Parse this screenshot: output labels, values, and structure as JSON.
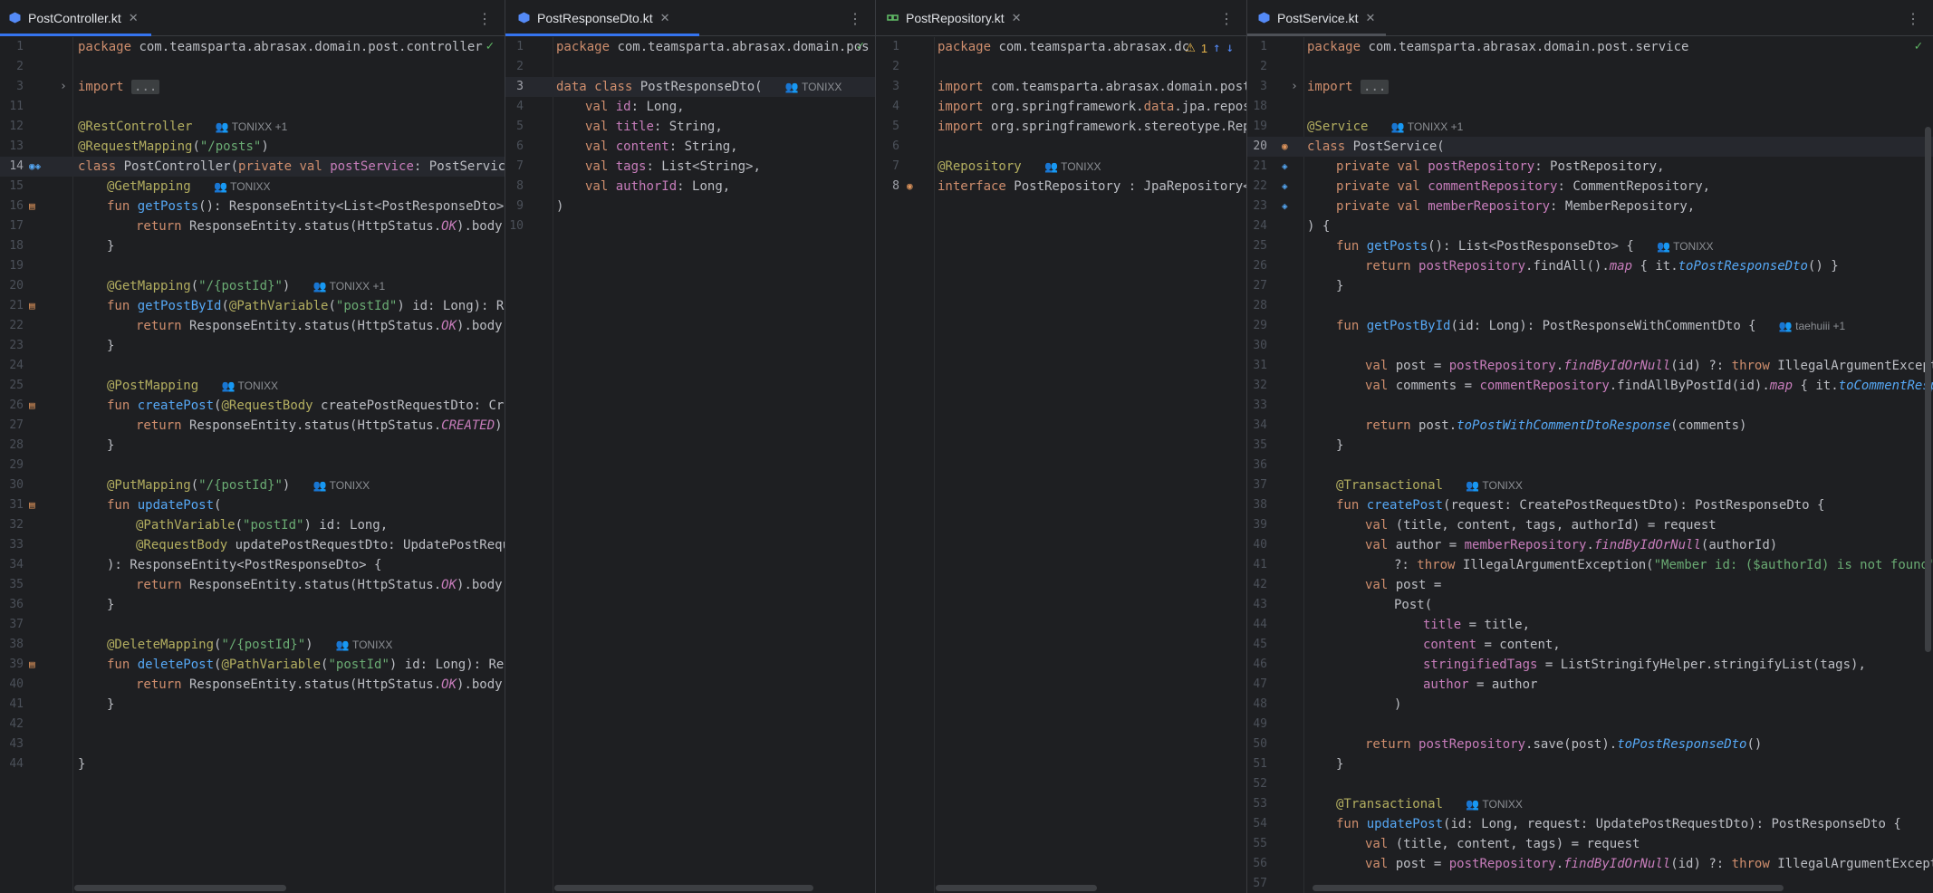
{
  "pane1": {
    "tab": "PostController.kt",
    "lines": [
      {
        "n": "1",
        "code": "package com.teamsparta.abrasax.domain.post.controller"
      },
      {
        "n": "2",
        "code": ""
      },
      {
        "n": "3",
        "code": "import ..."
      },
      {
        "n": "11",
        "code": ""
      },
      {
        "n": "12",
        "code": "@RestController  TONIXX +1"
      },
      {
        "n": "13",
        "code": "@RequestMapping(\"/posts\")"
      },
      {
        "n": "14",
        "code": "class PostController(private val postService: PostService)"
      },
      {
        "n": "15",
        "code": "@GetMapping  TONIXX"
      },
      {
        "n": "16",
        "code": "fun getPosts(): ResponseEntity<List<PostResponseDto>> {"
      },
      {
        "n": "17",
        "code": "return ResponseEntity.status(HttpStatus.OK).body(pos"
      },
      {
        "n": "18",
        "code": "}"
      },
      {
        "n": "19",
        "code": ""
      },
      {
        "n": "20",
        "code": "@GetMapping(\"/{postId}\")  TONIXX +1"
      },
      {
        "n": "21",
        "code": "fun getPostById(@PathVariable(\"postId\") id: Long): Respo"
      },
      {
        "n": "22",
        "code": "return ResponseEntity.status(HttpStatus.OK).body(pos"
      },
      {
        "n": "23",
        "code": "}"
      },
      {
        "n": "24",
        "code": ""
      },
      {
        "n": "25",
        "code": "@PostMapping  TONIXX"
      },
      {
        "n": "26",
        "code": "fun createPost(@RequestBody createPostRequestDto: Create"
      },
      {
        "n": "27",
        "code": "return ResponseEntity.status(HttpStatus.CREATED).boc"
      },
      {
        "n": "28",
        "code": "}"
      },
      {
        "n": "29",
        "code": ""
      },
      {
        "n": "30",
        "code": "@PutMapping(\"/{postId}\")  TONIXX"
      },
      {
        "n": "31",
        "code": "fun updatePost("
      },
      {
        "n": "32",
        "code": "@PathVariable(\"postId\") id: Long,"
      },
      {
        "n": "33",
        "code": "@RequestBody updatePostRequestDto: UpdatePostRequest"
      },
      {
        "n": "34",
        "code": "): ResponseEntity<PostResponseDto> {"
      },
      {
        "n": "35",
        "code": "return ResponseEntity.status(HttpStatus.OK).body(pos"
      },
      {
        "n": "36",
        "code": "}"
      },
      {
        "n": "37",
        "code": ""
      },
      {
        "n": "38",
        "code": "@DeleteMapping(\"/{postId}\")  TONIXX"
      },
      {
        "n": "39",
        "code": "fun deletePost(@PathVariable(\"postId\") id: Long): Respon"
      },
      {
        "n": "40",
        "code": "return ResponseEntity.status(HttpStatus.OK).body(pos"
      },
      {
        "n": "41",
        "code": "}"
      },
      {
        "n": "42",
        "code": ""
      },
      {
        "n": "43",
        "code": ""
      },
      {
        "n": "44",
        "code": "}"
      }
    ]
  },
  "pane2": {
    "tab": "PostResponseDto.kt",
    "lines": [
      {
        "n": "1",
        "code": "package com.teamsparta.abrasax.domain.pos"
      },
      {
        "n": "2",
        "code": ""
      },
      {
        "n": "3",
        "code": "data class PostResponseDto(  TONIXX"
      },
      {
        "n": "4",
        "code": "val id: Long,"
      },
      {
        "n": "5",
        "code": "val title: String,"
      },
      {
        "n": "6",
        "code": "val content: String,"
      },
      {
        "n": "7",
        "code": "val tags: List<String>,"
      },
      {
        "n": "8",
        "code": "val authorId: Long,"
      },
      {
        "n": "9",
        "code": ")"
      },
      {
        "n": "10",
        "code": ""
      }
    ]
  },
  "pane3": {
    "tab": "PostRepository.kt",
    "warning_count": "1",
    "lines": [
      {
        "n": "1",
        "code": "package com.teamsparta.abrasax.dc"
      },
      {
        "n": "2",
        "code": ""
      },
      {
        "n": "3",
        "code": "import com.teamsparta.abrasax.domain.post.m"
      },
      {
        "n": "4",
        "code": "import org.springframework.data.jpa.reposit"
      },
      {
        "n": "5",
        "code": "import org.springframework.stereotype.Repos"
      },
      {
        "n": "6",
        "code": ""
      },
      {
        "n": "7",
        "code": "@Repository  TONIXX"
      },
      {
        "n": "8",
        "code": "interface PostRepository : JpaRepository<Pc"
      }
    ]
  },
  "pane4": {
    "tab": "PostService.kt",
    "lines": [
      {
        "n": "1",
        "code": "package com.teamsparta.abrasax.domain.post.service"
      },
      {
        "n": "2",
        "code": ""
      },
      {
        "n": "3",
        "code": "import ..."
      },
      {
        "n": "18",
        "code": ""
      },
      {
        "n": "19",
        "code": "@Service  TONIXX +1"
      },
      {
        "n": "20",
        "code": "class PostService("
      },
      {
        "n": "21",
        "code": "private val postRepository: PostRepository,"
      },
      {
        "n": "22",
        "code": "private val commentRepository: CommentRepository,"
      },
      {
        "n": "23",
        "code": "private val memberRepository: MemberRepository,"
      },
      {
        "n": "24",
        "code": ") {"
      },
      {
        "n": "25",
        "code": "fun getPosts(): List<PostResponseDto> {  TONIXX"
      },
      {
        "n": "26",
        "code": "return postRepository.findAll().map { it.toPostResponseDto() }"
      },
      {
        "n": "27",
        "code": "}"
      },
      {
        "n": "28",
        "code": ""
      },
      {
        "n": "29",
        "code": "fun getPostById(id: Long): PostResponseWithCommentDto {  taehuiii +1"
      },
      {
        "n": "30",
        "code": ""
      },
      {
        "n": "31",
        "code": "val post = postRepository.findByIdOrNull(id) ?: throw IllegalArgumentExceptio"
      },
      {
        "n": "32",
        "code": "val comments = commentRepository.findAllByPostId(id).map { it.toCommentRespons"
      },
      {
        "n": "33",
        "code": ""
      },
      {
        "n": "34",
        "code": "return post.toPostWithCommentDtoResponse(comments)"
      },
      {
        "n": "35",
        "code": "}"
      },
      {
        "n": "36",
        "code": ""
      },
      {
        "n": "37",
        "code": "@Transactional  TONIXX"
      },
      {
        "n": "38",
        "code": "fun createPost(request: CreatePostRequestDto): PostResponseDto {"
      },
      {
        "n": "39",
        "code": "val (title, content, tags, authorId) = request"
      },
      {
        "n": "40",
        "code": "val author = memberRepository.findByIdOrNull(authorId)"
      },
      {
        "n": "41",
        "code": "?: throw IllegalArgumentException(\"Member id: ($authorId) is not found\")"
      },
      {
        "n": "42",
        "code": "val post ="
      },
      {
        "n": "43",
        "code": "Post("
      },
      {
        "n": "44",
        "code": "title = title,"
      },
      {
        "n": "45",
        "code": "content = content,"
      },
      {
        "n": "46",
        "code": "stringifiedTags = ListStringifyHelper.stringifyList(tags),"
      },
      {
        "n": "47",
        "code": "author = author"
      },
      {
        "n": "48",
        "code": ")"
      },
      {
        "n": "49",
        "code": ""
      },
      {
        "n": "50",
        "code": "return postRepository.save(post).toPostResponseDto()"
      },
      {
        "n": "51",
        "code": "}"
      },
      {
        "n": "52",
        "code": ""
      },
      {
        "n": "53",
        "code": "@Transactional  TONIXX"
      },
      {
        "n": "54",
        "code": "fun updatePost(id: Long, request: UpdatePostRequestDto): PostResponseDto {"
      },
      {
        "n": "55",
        "code": "val (title, content, tags) = request"
      },
      {
        "n": "56",
        "code": "val post = postRepository.findByIdOrNull(id) ?: throw IllegalArgumentExceptio"
      },
      {
        "n": "57",
        "code": ""
      }
    ]
  }
}
